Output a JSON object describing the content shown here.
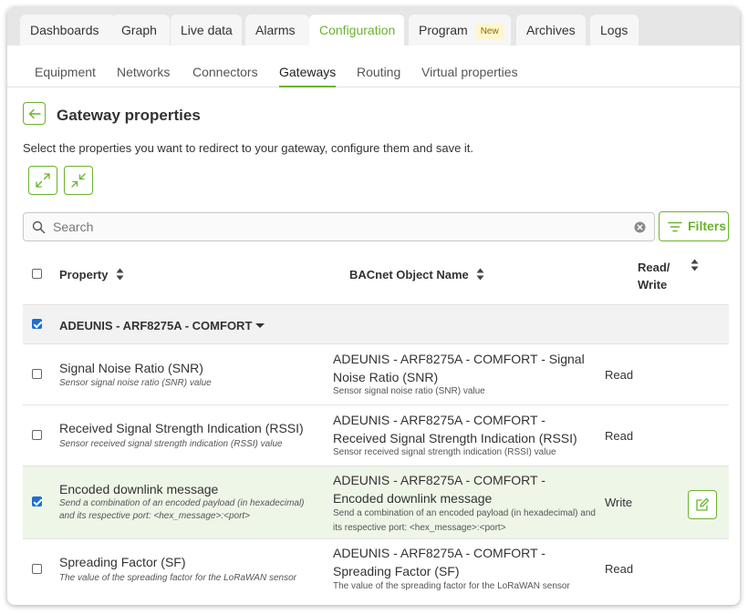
{
  "tabs": [
    {
      "label": "Dashboards"
    },
    {
      "label": "Graph"
    },
    {
      "label": "Live data"
    },
    {
      "label": "Alarms"
    },
    {
      "label": "Configuration",
      "active": true
    },
    {
      "label": "Program",
      "badge": "New"
    },
    {
      "label": "Archives"
    },
    {
      "label": "Logs"
    }
  ],
  "subtabs": [
    {
      "label": "Equipment"
    },
    {
      "label": "Networks"
    },
    {
      "label": "Connectors"
    },
    {
      "label": "Gateways",
      "active": true
    },
    {
      "label": "Routing"
    },
    {
      "label": "Virtual properties"
    }
  ],
  "page": {
    "title": "Gateway properties",
    "description": "Select the properties you want to redirect to your gateway, configure them and save it.",
    "back_icon": "arrow-left-icon",
    "expand_icon": "expand-icon",
    "collapse_icon": "collapse-icon"
  },
  "search": {
    "placeholder": "Search",
    "value": "",
    "filters_label": "Filters"
  },
  "table": {
    "headers": {
      "property": "Property",
      "bacnet": "BACnet Object Name",
      "rw_line1": "Read/",
      "rw_line2": "Write"
    },
    "group": {
      "label": "ADEUNIS - ARF8275A - COMFORT",
      "checked": true
    },
    "rows": [
      {
        "name": "Signal Noise Ratio (SNR)",
        "desc": "Sensor signal noise ratio (SNR) value",
        "bacnet_name": "ADEUNIS - ARF8275A - COMFORT - Signal Noise Ratio (SNR)",
        "bacnet_desc": "Sensor signal noise ratio (SNR) value",
        "rw": "Read",
        "checked": false
      },
      {
        "name": "Received Signal Strength Indication (RSSI)",
        "desc": "Sensor received signal strength indication (RSSI) value",
        "bacnet_name": "ADEUNIS - ARF8275A - COMFORT - Received Signal Strength Indication (RSSI)",
        "bacnet_desc": "Sensor received signal strength indication (RSSI) value",
        "rw": "Read",
        "checked": false
      },
      {
        "name": "Encoded downlink message",
        "desc": "Send a combination of an encoded payload (in hexadecimal) and its respective port: <hex_message>:<port>",
        "bacnet_name": "ADEUNIS - ARF8275A - COMFORT - Encoded downlink message",
        "bacnet_desc": "Send a combination of an encoded payload (in hexadecimal) and its respective port: <hex_message>:<port>",
        "rw": "Write",
        "checked": true
      },
      {
        "name": "Spreading Factor (SF)",
        "desc": "The value of the spreading factor for the LoRaWAN sensor",
        "bacnet_name": "ADEUNIS - ARF8275A - COMFORT - Spreading Factor (SF)",
        "bacnet_desc": "The value of the spreading factor for the LoRaWAN sensor",
        "rw": "Read",
        "checked": false
      }
    ]
  },
  "colors": {
    "accent": "#6ab22e",
    "selected_row": "#eef6e8",
    "checkbox": "#1f6fd0"
  }
}
